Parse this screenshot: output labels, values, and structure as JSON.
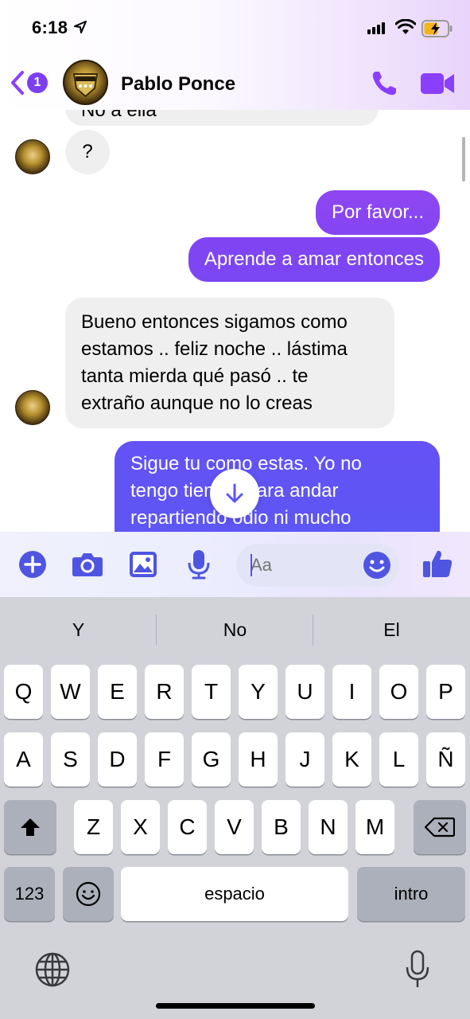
{
  "status_bar": {
    "time": "6:18",
    "icons": [
      "location-arrow-icon",
      "cellular-signal-icon",
      "wifi-icon",
      "battery-charging-icon"
    ]
  },
  "header": {
    "back_badge_count": "1",
    "contact_name": "Pablo Ponce",
    "accent_color": "#8a3ffc",
    "icons": [
      "back-chevron-icon",
      "phone-icon",
      "video-camera-icon"
    ]
  },
  "messages": [
    {
      "direction": "in",
      "text": "No a ella",
      "partially_visible": true
    },
    {
      "direction": "in",
      "text": "?"
    },
    {
      "direction": "out",
      "text": "Por favor..."
    },
    {
      "direction": "out",
      "text": "Aprende a amar entonces"
    },
    {
      "direction": "in",
      "lines": [
        "Bueno entonces sigamos como",
        "estamos .. feliz noche .. lástima",
        "tanta mierda qué pasó .. te",
        "extraño aunque no lo creas"
      ]
    },
    {
      "direction": "out",
      "lines": [
        "Sigue tu como estas. Yo no",
        "tengo tiempo para andar",
        "repartiendo odio ni mucho"
      ]
    }
  ],
  "composer": {
    "placeholder": "Aa",
    "icons": [
      "plus-circle-icon",
      "camera-icon",
      "photo-gallery-icon",
      "microphone-icon",
      "emoji-icon",
      "thumbs-up-icon"
    ],
    "accent_color": "#4f55e0"
  },
  "keyboard": {
    "suggestions": [
      "Y",
      "No",
      "El"
    ],
    "row1": [
      "Q",
      "W",
      "E",
      "R",
      "T",
      "Y",
      "U",
      "I",
      "O",
      "P"
    ],
    "row2": [
      "A",
      "S",
      "D",
      "F",
      "G",
      "H",
      "J",
      "K",
      "L",
      "Ñ"
    ],
    "row3": [
      "Z",
      "X",
      "C",
      "V",
      "B",
      "N",
      "M"
    ],
    "numbers_key": "123",
    "space_key": "espacio",
    "return_key": "intro"
  },
  "colors": {
    "incoming_bubble": "#efefef",
    "outgoing_gradient_top": "#9a45f0",
    "outgoing_gradient_bottom": "#5b57f5"
  }
}
